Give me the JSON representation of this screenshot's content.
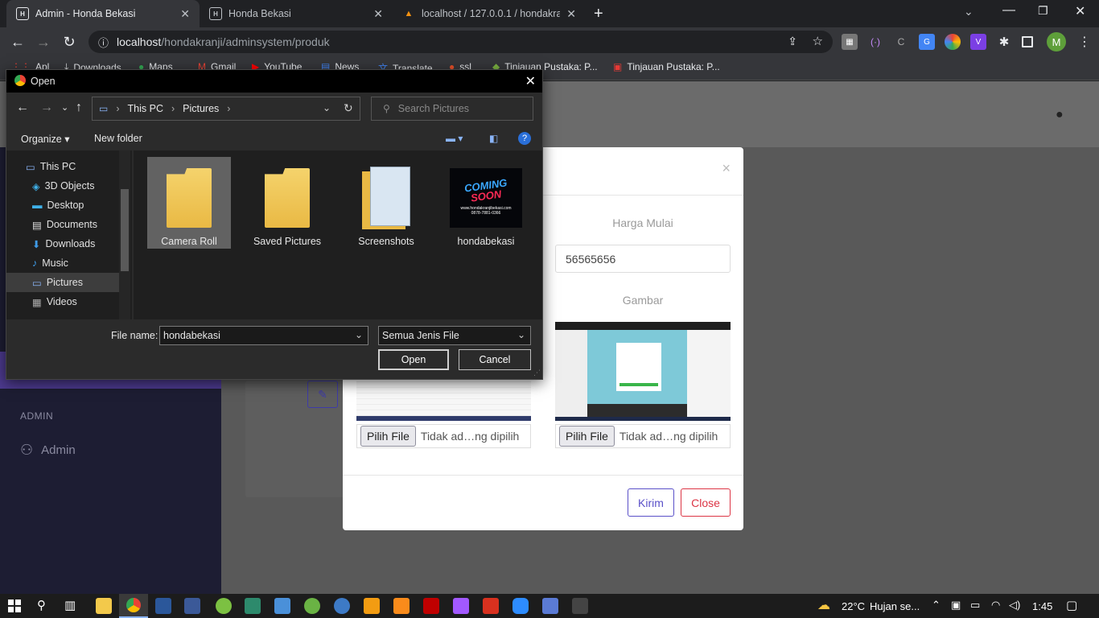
{
  "browser": {
    "tabs": [
      {
        "title": "Admin - Honda Bekasi",
        "active": true
      },
      {
        "title": "Honda Bekasi",
        "active": false
      },
      {
        "title": "localhost / 127.0.0.1 / hondakranji",
        "active": false
      }
    ],
    "url_host": "localhost",
    "url_path": "/hondakranji/adminsystem/produk",
    "avatar_letter": "M",
    "bookmarks": [
      "Apl",
      "Downloads",
      "Maps",
      "Gmail",
      "YouTube",
      "News",
      "Translate",
      "ssl",
      "Tinjauan Pustaka: P...",
      "Tinjauan Pustaka: P..."
    ]
  },
  "sidebar": {
    "section_label": "ADMIN",
    "items": [
      {
        "label": "Admin",
        "icon": "user-icon"
      }
    ]
  },
  "modal": {
    "harga_label": "Harga Mulai",
    "harga_value": "56565656",
    "gambar_label": "Gambar",
    "file_button": "Pilih File",
    "file_status": "Tidak ad…ng dipilih",
    "submit_label": "Kirim",
    "close_label": "Close",
    "close_x": "×"
  },
  "dialog": {
    "title": "Open",
    "breadcrumb": [
      "This PC",
      "Pictures"
    ],
    "search_placeholder": "Search Pictures",
    "organize_label": "Organize",
    "new_folder_label": "New folder",
    "help_label": "?",
    "nav_items": [
      {
        "label": "This PC",
        "level": 0
      },
      {
        "label": "3D Objects",
        "level": 1
      },
      {
        "label": "Desktop",
        "level": 1
      },
      {
        "label": "Documents",
        "level": 1
      },
      {
        "label": "Downloads",
        "level": 1
      },
      {
        "label": "Music",
        "level": 1
      },
      {
        "label": "Pictures",
        "level": 1,
        "selected": true
      },
      {
        "label": "Videos",
        "level": 1
      }
    ],
    "files": [
      {
        "name": "Camera Roll",
        "type": "folder",
        "selected": true
      },
      {
        "name": "Saved Pictures",
        "type": "folder"
      },
      {
        "name": "Screenshots",
        "type": "folder"
      },
      {
        "name": "hondabekasi",
        "type": "image"
      }
    ],
    "thumb_text_1": "COMING",
    "thumb_text_2": "SOON",
    "thumb_url": "www.hondakranjibekasi.com",
    "thumb_phone": "0878-7881-0366",
    "file_name_label": "File name:",
    "file_name_value": "hondabekasi",
    "filter_value": "Semua Jenis File",
    "open_label": "Open",
    "cancel_label": "Cancel"
  },
  "taskbar": {
    "temperature": "22°C",
    "weather": "Hujan se...",
    "time": "1:45"
  },
  "colors": {
    "accent_purple": "#4d3a8f",
    "sidebar_bg": "#1d1d33",
    "close_red": "#dc3545",
    "kirim_blue": "#5a50c8"
  }
}
